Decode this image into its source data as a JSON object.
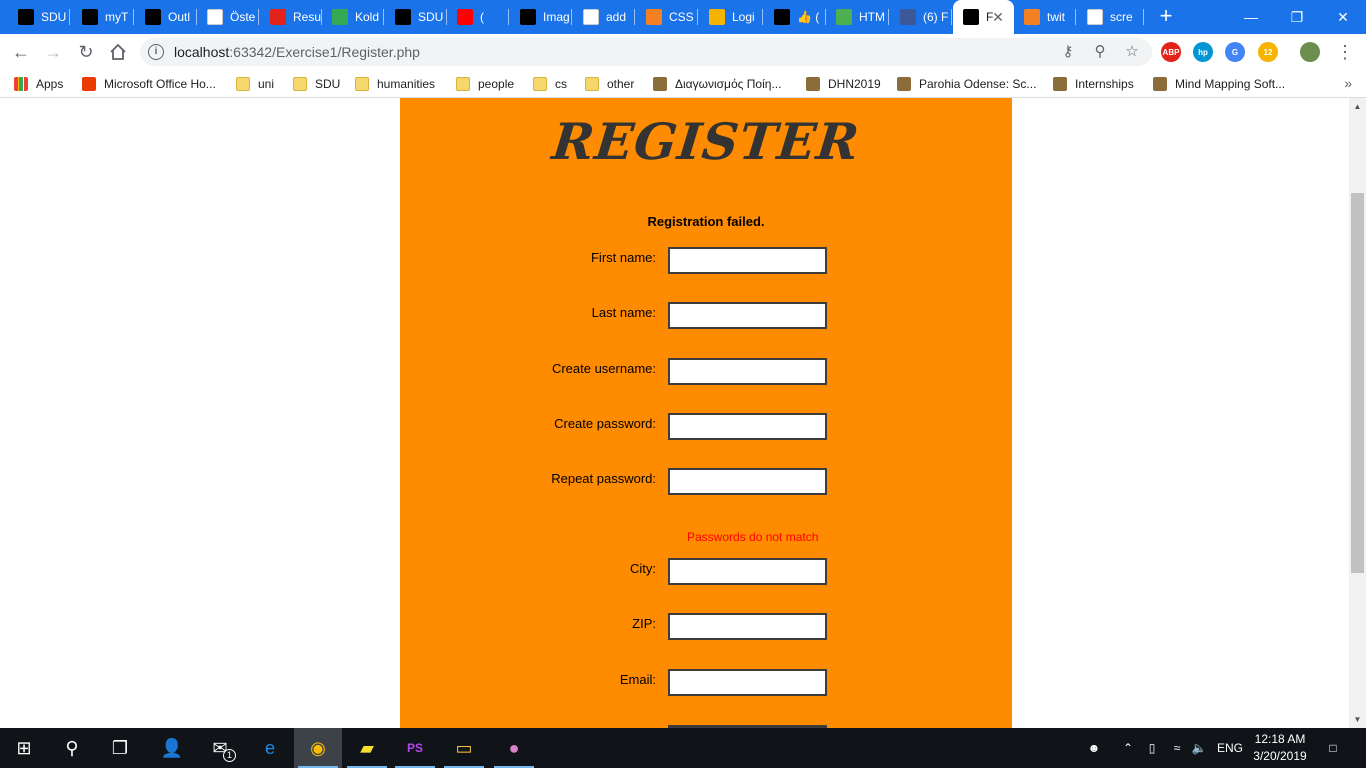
{
  "tabs": [
    {
      "title": "SDU",
      "icon": "sdu-icon",
      "color": "#000000"
    },
    {
      "title": "myT",
      "icon": "blackboard-icon",
      "color": "#000000"
    },
    {
      "title": "Outl",
      "icon": "sdu-icon",
      "color": "#000000"
    },
    {
      "title": "Öste",
      "icon": "oew-icon",
      "color": "#ffffff"
    },
    {
      "title": "Resu",
      "icon": "dsb-icon",
      "color": "#e2231a"
    },
    {
      "title": "Kold",
      "icon": "maps-icon",
      "color": "#34a853"
    },
    {
      "title": "SDU",
      "icon": "github-icon",
      "color": "#000000"
    },
    {
      "title": "(",
      "icon": "youtube-icon",
      "color": "#ff0000"
    },
    {
      "title": "Imag",
      "icon": "phpstorm-icon",
      "color": "#000000"
    },
    {
      "title": "add",
      "icon": "google-icon",
      "color": "#ffffff"
    },
    {
      "title": "CSS",
      "icon": "stackoverflow-icon",
      "color": "#f48024"
    },
    {
      "title": "Logi",
      "icon": "logo-icon",
      "color": "#f4b400"
    },
    {
      "title": "👍 (",
      "icon": "edit-icon",
      "color": "#000000"
    },
    {
      "title": "HTM",
      "icon": "w3schools-icon",
      "color": "#4caf50"
    },
    {
      "title": "(6) F",
      "icon": "facebook-icon",
      "color": "#3b5998"
    },
    {
      "title": "F",
      "icon": "phpstorm-icon",
      "color": "#000000",
      "active": true
    },
    {
      "title": "twit",
      "icon": "stackoverflow-icon",
      "color": "#f48024"
    },
    {
      "title": "scre",
      "icon": "google-icon",
      "color": "#ffffff"
    }
  ],
  "toolbar": {
    "url_host": "localhost",
    "url_path": ":63342/Exercise1/Register.php"
  },
  "extensions": [
    {
      "name": "adblock-plus-icon",
      "label": "ABP",
      "color": "#e2231a"
    },
    {
      "name": "hp-icon",
      "label": "hp",
      "color": "#0096d6"
    },
    {
      "name": "translate-icon",
      "label": "G",
      "color": "#4285f4"
    },
    {
      "name": "weather-icon",
      "label": "12",
      "color": "#f4b400"
    },
    {
      "name": "profile-avatar-icon",
      "label": "",
      "color": "#6b8e4e"
    }
  ],
  "bookmarks": [
    {
      "label": "Apps",
      "icon": "apps-grid-icon",
      "type": "apps"
    },
    {
      "label": "Microsoft Office Ho...",
      "icon": "office-icon",
      "type": "office"
    },
    {
      "label": "uni",
      "icon": "folder-icon",
      "type": "folder"
    },
    {
      "label": "SDU",
      "icon": "folder-icon",
      "type": "folder"
    },
    {
      "label": "humanities",
      "icon": "folder-icon",
      "type": "folder"
    },
    {
      "label": "people",
      "icon": "folder-icon",
      "type": "folder"
    },
    {
      "label": "cs",
      "icon": "folder-icon",
      "type": "folder"
    },
    {
      "label": "other",
      "icon": "folder-icon",
      "type": "folder"
    },
    {
      "label": "Διαγωνισμός Ποίη...",
      "icon": "contest-icon",
      "type": "site"
    },
    {
      "label": "DHN2019",
      "icon": "dhn-icon",
      "type": "site"
    },
    {
      "label": "Parohia Odense: Sc...",
      "icon": "church-icon",
      "type": "site"
    },
    {
      "label": "Internships",
      "icon": "internships-icon",
      "type": "site"
    },
    {
      "label": "Mind Mapping Soft...",
      "icon": "mindmap-icon",
      "type": "site"
    }
  ],
  "page": {
    "title": "REGISTER",
    "status": "Registration failed.",
    "fields": [
      {
        "label": "First name:",
        "value": ""
      },
      {
        "label": "Last name:",
        "value": ""
      },
      {
        "label": "Create username:",
        "value": ""
      },
      {
        "label": "Create password:",
        "value": ""
      },
      {
        "label": "Repeat password:",
        "value": ""
      },
      {
        "label": "City:",
        "value": ""
      },
      {
        "label": "ZIP:",
        "value": ""
      },
      {
        "label": "Email:",
        "value": ""
      }
    ],
    "error": "Passwords do not match",
    "panel_color": "#ff8c00",
    "error_color": "#ff0000"
  },
  "taskbar": {
    "apps": [
      {
        "name": "start-icon"
      },
      {
        "name": "search-icon"
      },
      {
        "name": "task-view-icon"
      },
      {
        "name": "explorer-user-icon"
      },
      {
        "name": "mail-icon",
        "badge": "1"
      },
      {
        "name": "edge-icon"
      },
      {
        "name": "chrome-icon",
        "active": true
      },
      {
        "name": "sticky-notes-icon"
      },
      {
        "name": "phpstorm-icon"
      },
      {
        "name": "file-explorer-icon"
      },
      {
        "name": "github-desktop-icon"
      }
    ],
    "language": "ENG",
    "time": "12:18 AM",
    "date": "3/20/2019"
  }
}
